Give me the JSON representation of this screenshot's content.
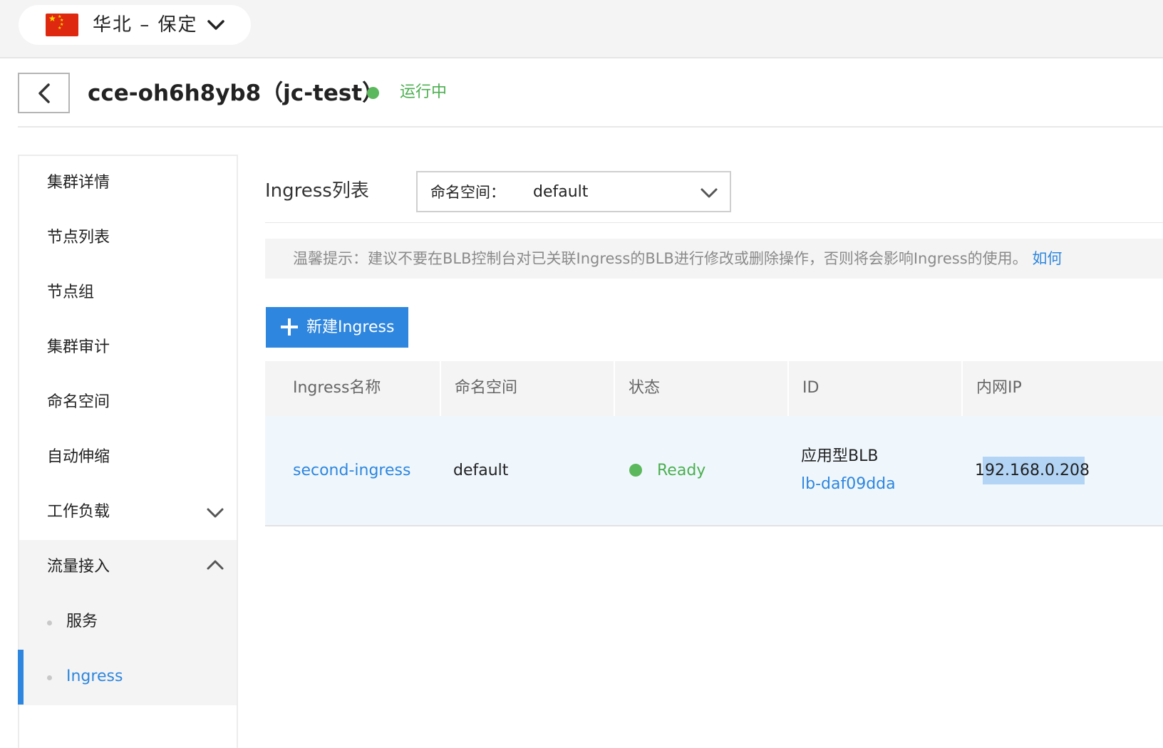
{
  "region": {
    "label": "华北 – 保定",
    "flag_icon": "china-flag"
  },
  "header": {
    "back_icon": "chevron-left-icon",
    "cluster_title": "cce-oh6h8yb8（jc-test）",
    "status": "运行中"
  },
  "sidebar": {
    "items": [
      {
        "label": "集群详情"
      },
      {
        "label": "节点列表"
      },
      {
        "label": "节点组"
      },
      {
        "label": "集群审计"
      },
      {
        "label": "命名空间"
      },
      {
        "label": "自动伸缩"
      },
      {
        "label": "工作负载"
      },
      {
        "label": "流量接入"
      }
    ],
    "sub_items": [
      {
        "label": "服务"
      },
      {
        "label": "Ingress"
      }
    ],
    "active_sub": "Ingress"
  },
  "main": {
    "list_title": "Ingress列表",
    "namespace_select": {
      "label": "命名空间：",
      "value": "default"
    },
    "hint": {
      "text": "温馨提示：建议不要在BLB控制台对已关联Ingress的BLB进行修改或删除操作，否则将会影响Ingress的使用。",
      "link": "如何"
    },
    "new_button": "新建Ingress",
    "table": {
      "columns": [
        "Ingress名称",
        "命名空间",
        "状态",
        "ID",
        "内网IP"
      ],
      "rows": [
        {
          "name": "second-ingress",
          "namespace": "default",
          "status": "Ready",
          "id_type": "应用型BLB",
          "id": "lb-daf09dda",
          "ip": "192.168.0.208"
        }
      ]
    }
  },
  "colors": {
    "accent": "#2e86de",
    "success": "#4caf50",
    "sidebar_active_bg": "#f4f4f4"
  }
}
